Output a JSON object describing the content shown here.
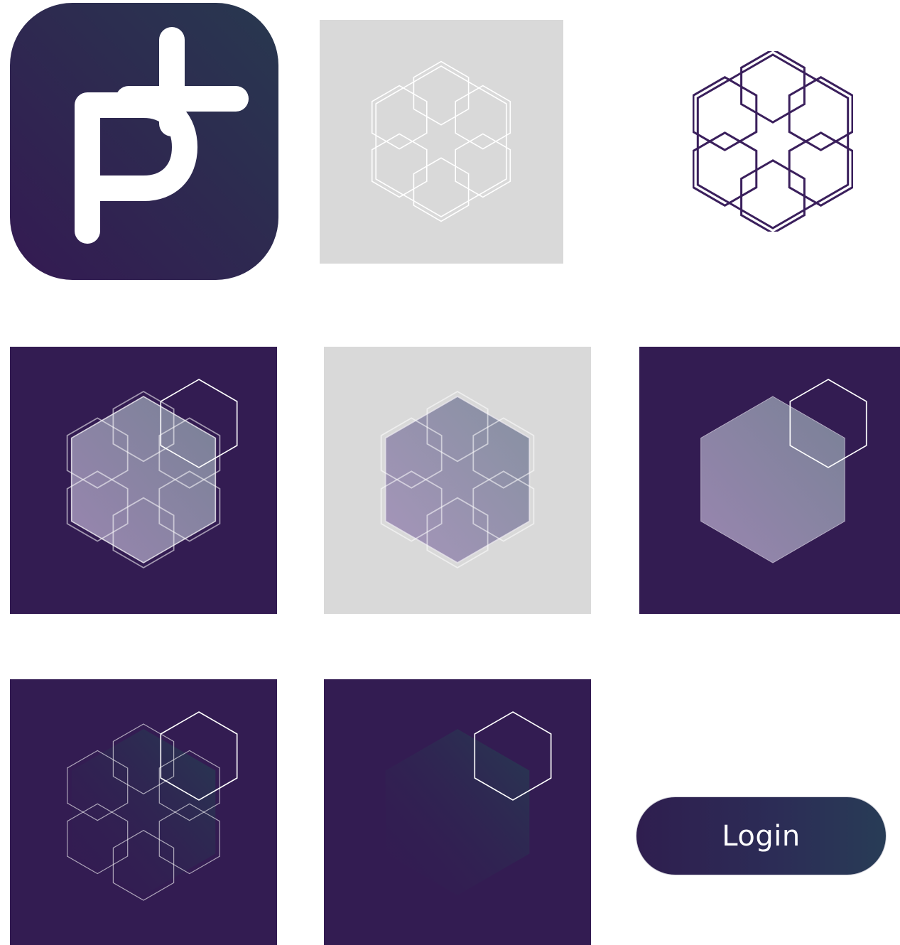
{
  "colors": {
    "brand_purple": "#331c52",
    "brand_teal": "#273a52",
    "tile_gray": "#d9d9d9",
    "outline_white": "#ffffff",
    "outline_purple": "#3a1f5c"
  },
  "icons": {
    "app_icon": "p-plus-logo-icon",
    "pattern": "hexagon-flower-pattern-icon",
    "single_hexagon": "hexagon-outline-icon"
  },
  "login": {
    "label": "Login"
  }
}
